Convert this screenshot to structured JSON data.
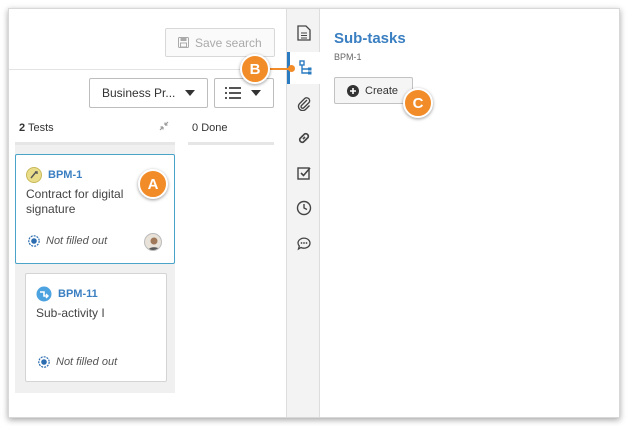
{
  "toolbar": {
    "save_search_label": "Save search"
  },
  "filters": {
    "business_label": "Business Pr..."
  },
  "columns": [
    {
      "count": "2",
      "label": "Tests"
    },
    {
      "count": "0",
      "label": "Done"
    }
  ],
  "cards": [
    {
      "key": "BPM-1",
      "title": "Contract for digital signature",
      "status": "Not filled out"
    },
    {
      "key": "BPM-11",
      "title": "Sub-activity I",
      "status": "Not filled out"
    }
  ],
  "panel": {
    "title": "Sub-tasks",
    "subtitle": "BPM-1",
    "create_label": "Create"
  },
  "callouts": {
    "a": "A",
    "b": "B",
    "c": "C"
  },
  "colors": {
    "accent": "#3a7fc1",
    "callout": "#f28c28",
    "selected_border": "#4aa3c8"
  }
}
